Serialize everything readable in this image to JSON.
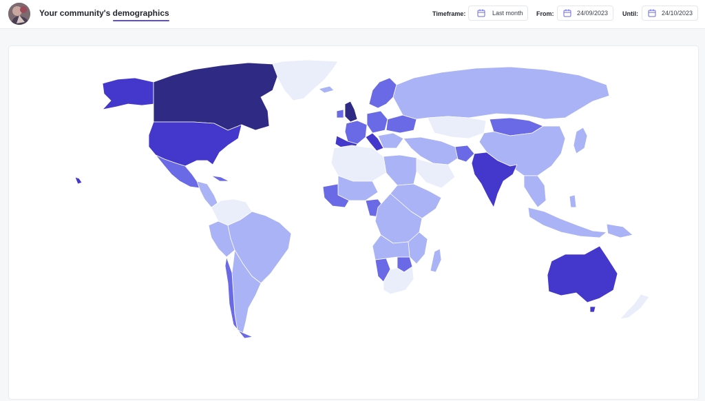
{
  "header": {
    "title_prefix": "Your community's ",
    "title_emphasis": "demographics",
    "timeframe_label": "Timeframe:",
    "timeframe_value": "Last month",
    "from_label": "From:",
    "from_value": "24/09/2023",
    "until_label": "Until:",
    "until_value": "24/10/2023"
  },
  "icons": {
    "calendar": "calendar-icon",
    "avatar": "user-avatar"
  },
  "map_palette": {
    "none": "#eaeefb",
    "low": "#a9b3f5",
    "medium": "#6a69e6",
    "high": "#4337cc",
    "highest": "#2f2a83"
  },
  "countries": [
    {
      "name": "Canada",
      "level": "highest"
    },
    {
      "name": "United States",
      "level": "high"
    },
    {
      "name": "Alaska",
      "level": "high"
    },
    {
      "name": "Mexico",
      "level": "medium"
    },
    {
      "name": "Cuba",
      "level": "medium"
    },
    {
      "name": "Greenland",
      "level": "none"
    },
    {
      "name": "Brazil",
      "level": "low"
    },
    {
      "name": "Argentina",
      "level": "low"
    },
    {
      "name": "Chile",
      "level": "medium"
    },
    {
      "name": "Colombia",
      "level": "none"
    },
    {
      "name": "Venezuela",
      "level": "none"
    },
    {
      "name": "Peru",
      "level": "low"
    },
    {
      "name": "United Kingdom",
      "level": "highest"
    },
    {
      "name": "Ireland",
      "level": "medium"
    },
    {
      "name": "Spain",
      "level": "high"
    },
    {
      "name": "France",
      "level": "medium"
    },
    {
      "name": "Italy",
      "level": "high"
    },
    {
      "name": "Germany",
      "level": "medium"
    },
    {
      "name": "Scandinavia",
      "level": "medium"
    },
    {
      "name": "Ukraine",
      "level": "medium"
    },
    {
      "name": "Russia",
      "level": "low"
    },
    {
      "name": "Kazakhstan",
      "level": "none"
    },
    {
      "name": "Mongolia",
      "level": "medium"
    },
    {
      "name": "China",
      "level": "low"
    },
    {
      "name": "India",
      "level": "high"
    },
    {
      "name": "Afghanistan",
      "level": "medium"
    },
    {
      "name": "Saudi Arabia",
      "level": "none"
    },
    {
      "name": "Algeria",
      "level": "none"
    },
    {
      "name": "Egypt",
      "level": "low"
    },
    {
      "name": "Mali",
      "level": "low"
    },
    {
      "name": "West Africa",
      "level": "medium"
    },
    {
      "name": "Nigeria",
      "level": "medium"
    },
    {
      "name": "DR Congo",
      "level": "low"
    },
    {
      "name": "Namibia",
      "level": "medium"
    },
    {
      "name": "Zimbabwe",
      "level": "medium"
    },
    {
      "name": "South Africa",
      "level": "none"
    },
    {
      "name": "Madagascar",
      "level": "low"
    },
    {
      "name": "Indonesia",
      "level": "low"
    },
    {
      "name": "Japan",
      "level": "low"
    },
    {
      "name": "Australia",
      "level": "high"
    },
    {
      "name": "New Zealand",
      "level": "none"
    }
  ]
}
